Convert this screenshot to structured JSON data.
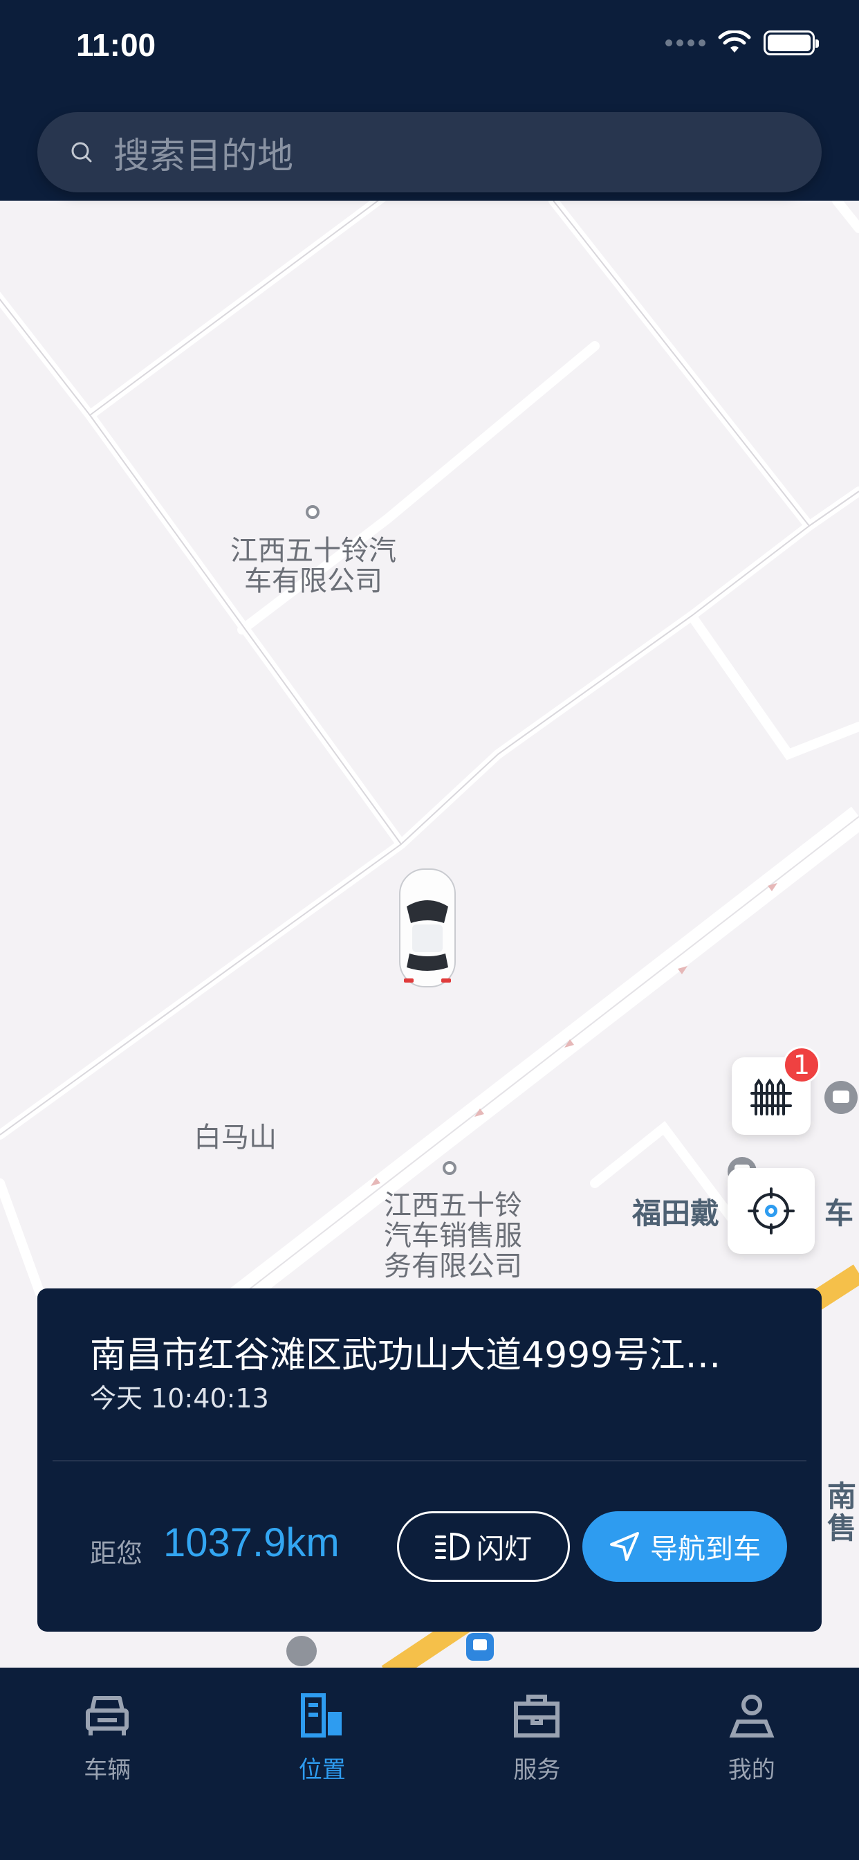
{
  "status_bar": {
    "time": "11:00"
  },
  "search": {
    "placeholder": "搜索目的地"
  },
  "map": {
    "poi_1": {
      "line1": "江西五十铃汽",
      "line2": "车有限公司"
    },
    "poi_2": {
      "label": "白马山"
    },
    "poi_3": {
      "line1": "江西五十铃",
      "line2": "汽车销售服",
      "line3": "务有限公司"
    },
    "poi_4": {
      "label": "福田戴"
    },
    "poi_4_tail": {
      "label": "车"
    },
    "poi_5": {
      "line1": "南",
      "line2": "售"
    },
    "fence_badge": "1"
  },
  "card": {
    "address": "南昌市红谷滩区武功山大道4999号江…",
    "time": "今天 10:40:13",
    "distance_label": "距您",
    "distance_value": "1037.9km",
    "flash_button": "闪灯",
    "navigate_button": "导航到车"
  },
  "tabs": [
    {
      "label": "车辆",
      "icon": "car-icon",
      "active": false
    },
    {
      "label": "位置",
      "icon": "location-building-icon",
      "active": true
    },
    {
      "label": "服务",
      "icon": "toolbox-icon",
      "active": false
    },
    {
      "label": "我的",
      "icon": "person-icon",
      "active": false
    }
  ],
  "colors": {
    "header_bg": "#0c1e3b",
    "accent": "#2e9cf0",
    "badge": "#ef4141",
    "map_bg": "#f4f2f5"
  }
}
